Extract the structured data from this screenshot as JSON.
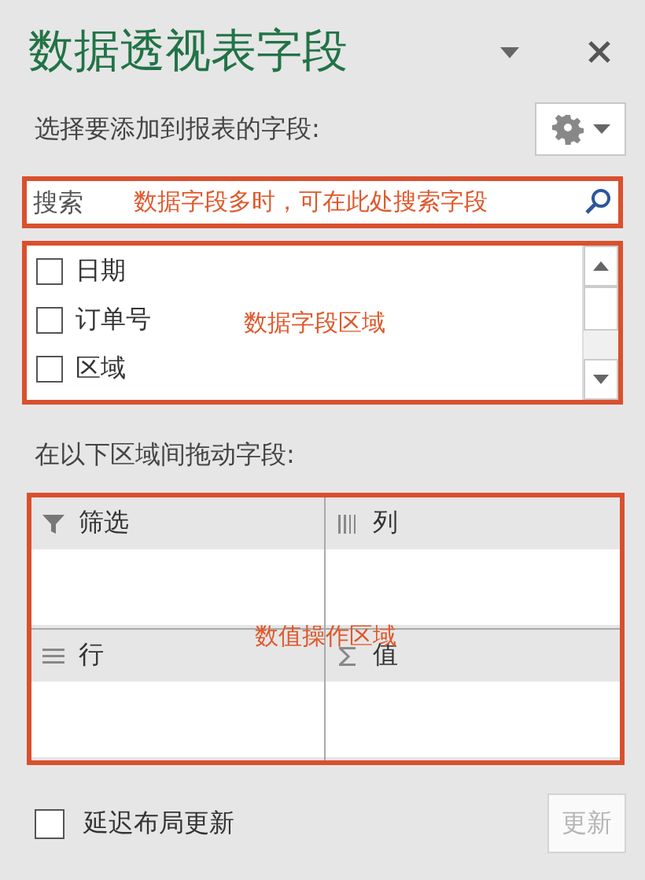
{
  "pane": {
    "title": "数据透视表字段",
    "fields_label": "选择要添加到报表的字段:"
  },
  "search": {
    "placeholder": "搜索",
    "annotation": "数据字段多时，可在此处搜索字段"
  },
  "field_list": {
    "annotation": "数据字段区域",
    "items": [
      {
        "label": "日期",
        "checked": false
      },
      {
        "label": "订单号",
        "checked": false
      },
      {
        "label": "区域",
        "checked": false
      }
    ]
  },
  "drag_label": "在以下区域间拖动字段:",
  "areas": {
    "annotation": "数值操作区域",
    "items": [
      {
        "kind": "filter",
        "label": "筛选"
      },
      {
        "kind": "columns",
        "label": "列"
      },
      {
        "kind": "rows",
        "label": "行"
      },
      {
        "kind": "values",
        "label": "值"
      }
    ]
  },
  "defer_update": {
    "label": "延迟布局更新",
    "checked": false
  },
  "update_button": {
    "label": "更新",
    "disabled": true
  }
}
